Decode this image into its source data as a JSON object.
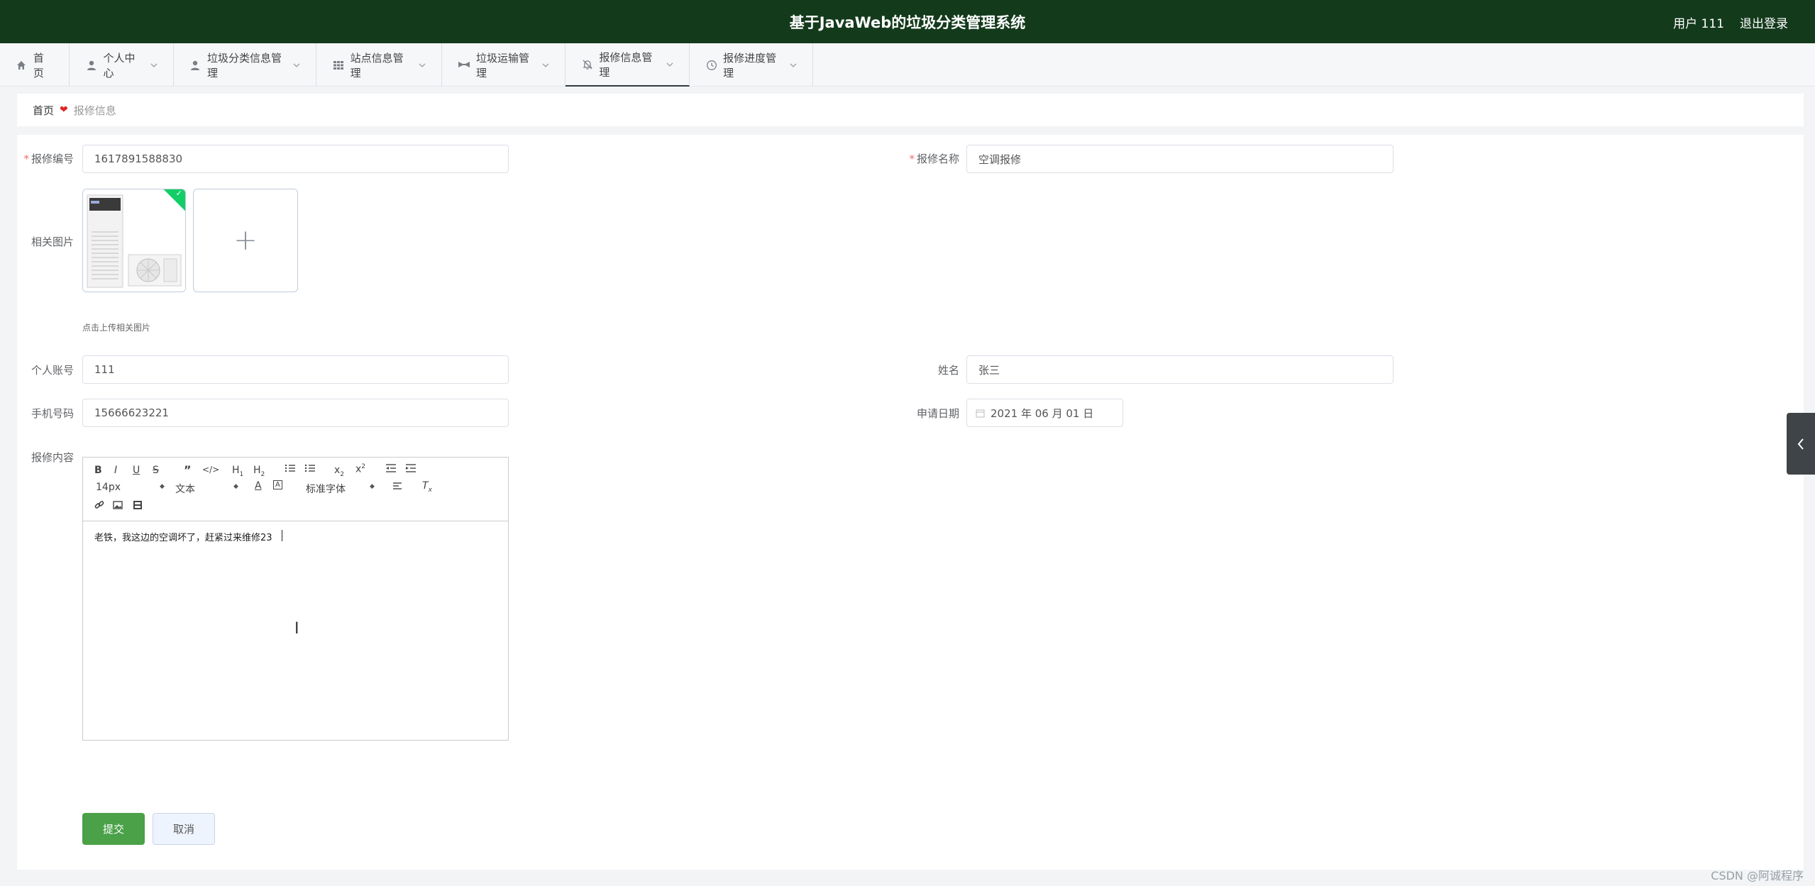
{
  "header": {
    "title": "基于JavaWeb的垃圾分类管理系统",
    "user": "用户 111",
    "logout": "退出登录"
  },
  "nav": [
    {
      "label": "首页",
      "icon": "home-icon",
      "active": false
    },
    {
      "label": "个人中心",
      "icon": "user-icon",
      "active": false
    },
    {
      "label": "垃圾分类信息管理",
      "icon": "user-icon",
      "active": false
    },
    {
      "label": "站点信息管理",
      "icon": "grid-icon",
      "active": false
    },
    {
      "label": "垃圾运输管理",
      "icon": "truck-icon",
      "active": false
    },
    {
      "label": "报修信息管理",
      "icon": "bell-off-icon",
      "active": true
    },
    {
      "label": "报修进度管理",
      "icon": "clock-icon",
      "active": false
    }
  ],
  "breadcrumb": {
    "home": "首页",
    "current": "报修信息"
  },
  "form": {
    "repair_no": {
      "label": "报修编号",
      "value": "1617891588830"
    },
    "repair_name": {
      "label": "报修名称",
      "value": "空调报修"
    },
    "images": {
      "label": "相关图片",
      "hint": "点击上传相关图片"
    },
    "account": {
      "label": "个人账号",
      "value": "111"
    },
    "name": {
      "label": "姓名",
      "value": "张三"
    },
    "phone": {
      "label": "手机号码",
      "value": "15666623221"
    },
    "apply_date": {
      "label": "申请日期",
      "value": "2021 年 06 月 01 日"
    },
    "content": {
      "label": "报修内容",
      "value": "老铁，我这边的空调坏了，赶紧过来维修23"
    }
  },
  "editor": {
    "font_size": "14px",
    "text_type": "文本",
    "font_family": "标准字体"
  },
  "buttons": {
    "submit": "提交",
    "cancel": "取消"
  },
  "watermark": "CSDN @阿诚程序",
  "colors": {
    "header_bg": "#143a1c",
    "submit_bg": "#4aa147",
    "required": "#f56c6c",
    "success_badge": "#13ce66"
  }
}
